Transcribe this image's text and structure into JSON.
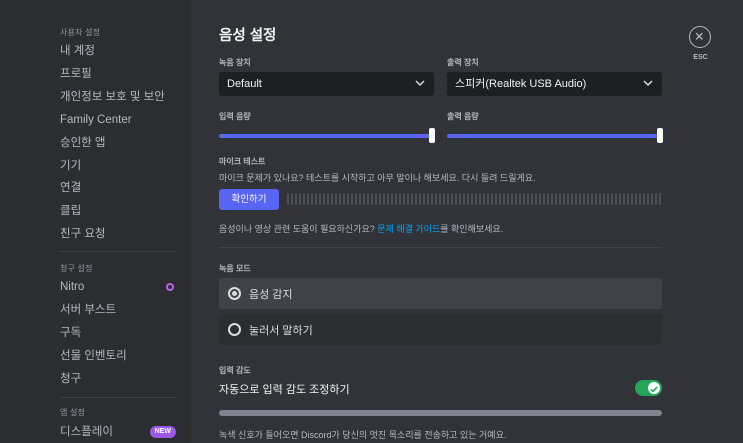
{
  "sidebar": {
    "user_settings_header": "사용자 설정",
    "user_items": [
      "내 계정",
      "프로필",
      "개인정보 보호 및 보안",
      "Family Center",
      "승인한 앱",
      "기기",
      "연결",
      "클립",
      "친구 요청"
    ],
    "billing_header": "청구 설정",
    "billing_items": [
      "Nitro",
      "서버 부스트",
      "구독",
      "선물 인벤토리",
      "청구"
    ],
    "app_header": "앱 설정",
    "app_items": [
      "디스플레이"
    ],
    "new_badge": "NEW"
  },
  "main": {
    "title": "음성 설정",
    "input_device_label": "녹음 장치",
    "input_device_value": "Default",
    "output_device_label": "출력 장치",
    "output_device_value": "스피커(Realtek USB Audio)",
    "input_volume_label": "입력 음량",
    "output_volume_label": "출력 음량",
    "input_volume": 100,
    "output_volume": 100,
    "mic_test_label": "마이크 테스트",
    "mic_test_desc": "마이크 문제가 있나요? 테스트를 시작하고 아무 말이나 해보세요. 다시 들려 드릴게요.",
    "check_button": "확인하기",
    "help_prefix": "음성이나 영상 관련 도움이 필요하신가요? ",
    "help_link": "문제 해결 가이드",
    "help_suffix": "를 확인해보세요.",
    "input_mode_label": "녹음 모드",
    "mode_voice": "음성 감지",
    "mode_ptt": "눌러서 말하기",
    "sensitivity_label": "입력 감도",
    "auto_sensitivity": "자동으로 입력 감도 조정하기",
    "auto_sensitivity_on": true,
    "sensitivity_desc": "녹색 신호가 들어오면 Discord가 당신의 멋진 목소리를 전송하고 있는 거예요."
  },
  "close": {
    "esc_label": "ESC"
  },
  "colors": {
    "accent": "#5865f2",
    "link": "#00a8fc",
    "toggle_on": "#23a55a",
    "nitro": "#c061f0"
  }
}
